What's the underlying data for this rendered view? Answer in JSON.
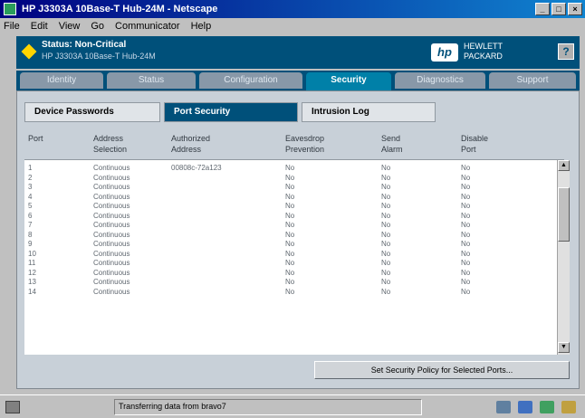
{
  "window": {
    "title": "HP J3303A 10Base-T Hub-24M - Netscape"
  },
  "window_buttons": {
    "minimize": "_",
    "maximize": "□",
    "close": "×"
  },
  "menu": [
    "File",
    "Edit",
    "View",
    "Go",
    "Communicator",
    "Help"
  ],
  "banner": {
    "status": "Status: Non-Critical",
    "device": "HP J3303A 10Base-T Hub-24M",
    "logo_text": "hp",
    "brand_line1": "HEWLETT",
    "brand_line2": "PACKARD",
    "help_label": "?",
    "accent_color": "#00507a",
    "status_icon_color": "#ffd400"
  },
  "tabs": [
    {
      "label": "Identity"
    },
    {
      "label": "Status"
    },
    {
      "label": "Configuration"
    },
    {
      "label": "Security",
      "active": true
    },
    {
      "label": "Diagnostics"
    },
    {
      "label": "Support"
    }
  ],
  "subtabs": [
    {
      "label": "Device Passwords"
    },
    {
      "label": "Port Security",
      "active": true
    },
    {
      "label": "Intrusion Log"
    }
  ],
  "table": {
    "headers": [
      [
        "Port",
        ""
      ],
      [
        "Address",
        "Selection"
      ],
      [
        "Authorized",
        "Address"
      ],
      [
        "Eavesdrop",
        "Prevention"
      ],
      [
        "Send",
        "Alarm"
      ],
      [
        "Disable",
        "Port"
      ]
    ],
    "rows": [
      [
        "1",
        "Continuous",
        "00808c-72a123",
        "No",
        "No",
        "No"
      ],
      [
        "2",
        "Continuous",
        "",
        "No",
        "No",
        "No"
      ],
      [
        "3",
        "Continuous",
        "",
        "No",
        "No",
        "No"
      ],
      [
        "4",
        "Continuous",
        "",
        "No",
        "No",
        "No"
      ],
      [
        "5",
        "Continuous",
        "",
        "No",
        "No",
        "No"
      ],
      [
        "6",
        "Continuous",
        "",
        "No",
        "No",
        "No"
      ],
      [
        "7",
        "Continuous",
        "",
        "No",
        "No",
        "No"
      ],
      [
        "8",
        "Continuous",
        "",
        "No",
        "No",
        "No"
      ],
      [
        "9",
        "Continuous",
        "",
        "No",
        "No",
        "No"
      ],
      [
        "10",
        "Continuous",
        "",
        "No",
        "No",
        "No"
      ],
      [
        "11",
        "Continuous",
        "",
        "No",
        "No",
        "No"
      ],
      [
        "12",
        "Continuous",
        "",
        "No",
        "No",
        "No"
      ],
      [
        "13",
        "Continuous",
        "",
        "No",
        "No",
        "No"
      ],
      [
        "14",
        "Continuous",
        "",
        "No",
        "No",
        "No"
      ]
    ]
  },
  "scroll_up_label": "▲",
  "scroll_down_label": "▼",
  "policy_button": "Set Security Policy for Selected Ports...",
  "statusbar": {
    "text": "Transferring data from bravo7"
  }
}
